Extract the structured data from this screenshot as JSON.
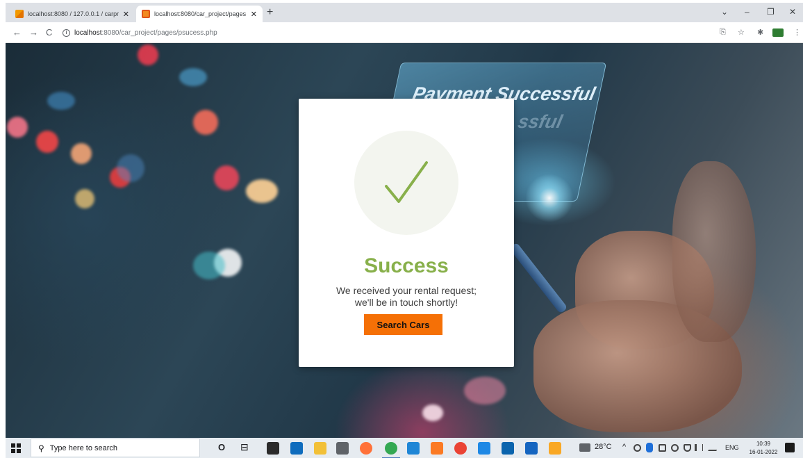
{
  "browser": {
    "tabs": [
      {
        "title": "localhost:8080 / 127.0.0.1 / carpr",
        "close": "✕"
      },
      {
        "title": "localhost:8080/car_project/pages",
        "close": "✕"
      }
    ],
    "new_tab": "+",
    "window_controls": {
      "chevron": "⌄",
      "minimize": "–",
      "maximize": "❐",
      "close": "✕"
    },
    "nav": {
      "back": "←",
      "forward": "→",
      "reload": "C"
    },
    "url": {
      "host": "localhost",
      "rest": ":8080/car_project/pages/psucess.php"
    },
    "toolbar_icons": {
      "share": "⎘",
      "star": "☆",
      "extensions": "✱",
      "menu": "⋮"
    }
  },
  "page": {
    "holo_text": "Payment Successful",
    "holo_text_ghost": "ssful",
    "card": {
      "title": "Success",
      "message_line1": "We received your rental request;",
      "message_line2": "we'll be in touch shortly!",
      "button_label": "Search Cars",
      "check_color": "#88b04b",
      "button_color": "#f57006"
    }
  },
  "taskbar": {
    "search_placeholder": "Type here to search",
    "search_icon": "⚲",
    "cortana": "O",
    "taskview": "⊟",
    "apps": [
      "store",
      "mail",
      "file-explorer",
      "settings",
      "firefox",
      "chrome",
      "vscode",
      "xampp",
      "chrome-alt",
      "edge",
      "outlook",
      "photos",
      "pin"
    ],
    "weather": "28°C",
    "tray_up": "^",
    "language": "ENG",
    "time": "10:39",
    "date": "16-01-2022"
  }
}
